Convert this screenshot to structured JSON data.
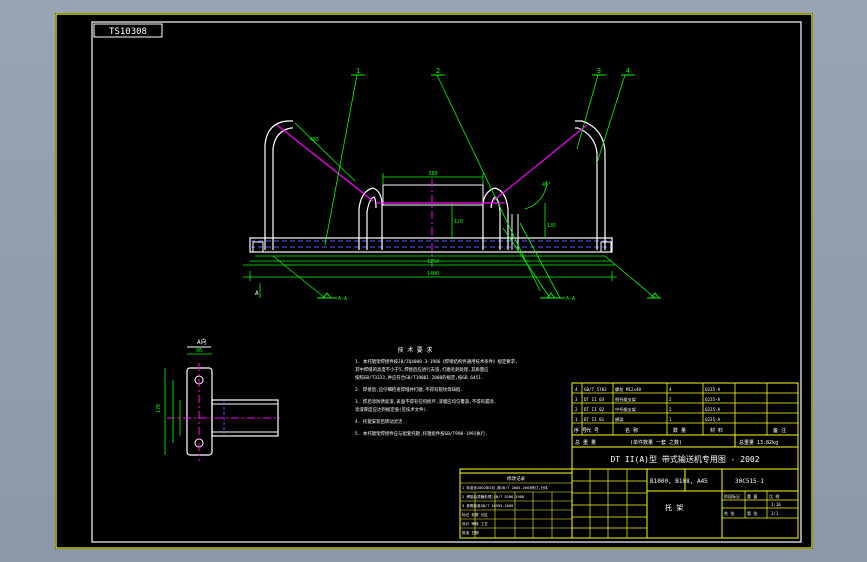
{
  "drawing": {
    "code_box": "TS10308",
    "part_labels": [
      "1",
      "2",
      "3",
      "4"
    ],
    "view_label": "A向",
    "section_label": "A",
    "weld_symbols": [
      "A-A",
      "A-A"
    ],
    "dims": {
      "center_len": "380",
      "center_h": "120",
      "side_len": "465",
      "angle": "45°",
      "total_w": "1250",
      "base_len": "1400",
      "side_h": "135",
      "plate_h": "170",
      "plate_w": "90"
    },
    "notes_title": "技 术 要 求",
    "notes": [
      "1. 本托辊架焊接件按JB/ZQ4000.3-1986《焊接结构件通用技术条件》规定要求,",
      "   其中焊缝的高度不小于5,焊接后应进行去渣,打磨毛刺处理,其质量应",
      "   按照GB/T3323,并应符合GB/T19001-2000的规定,按GB 6451.",
      "2. 焊接后,应仔细检查焊缝并打磨,不得有裂纹等缺陷.",
      "3. 焊后涂防锈底漆,表面不得有任何损坏,漆膜应均匀覆盖,不得有漏涂.",
      "   涂漆厚度应达到规定值(见技术文件).",
      "4. 托辊安装后转动灵活.",
      "5. 本托辊架焊接件应与配套托辊,托辊组件按GB/T990-1991执行."
    ],
    "mini_table_title": "修改记录",
    "mini_table_rows": [
      "1 标准化2002年5月,按JB/T 2003-2003修订,分体",
      "2 焊接后漆膜处理,GB/T 9286-1988",
      "3 参照标准GB/T 10595-2009",
      "标记  处数  分区",
      "设计  审核  工艺",
      "批准  日期"
    ]
  },
  "parts_list": {
    "rows": [
      {
        "no": "1",
        "code": "DT II 01",
        "name": "横梁",
        "qty": "1",
        "material": "Q235-A",
        "remark": ""
      },
      {
        "no": "2",
        "code": "DT II 02",
        "name": "中托辊支架",
        "qty": "2",
        "material": "Q235-A",
        "remark": ""
      },
      {
        "no": "3",
        "code": "DT II 03",
        "name": "侧托辊支架",
        "qty": "2",
        "material": "Q235-A",
        "remark": ""
      },
      {
        "no": "4",
        "code": "GB/T 5783",
        "name": "螺栓 M12×40",
        "qty": "4",
        "material": "Q235-A",
        "remark": ""
      }
    ],
    "header": [
      "序 号",
      "代 号",
      "名 称",
      "数 量",
      "材 料",
      "备 注"
    ]
  },
  "title_block": {
    "weight_label": "总 重 量",
    "standard_note": "(单件数量 一套 之数)",
    "total_weight": "总重量 13.82kg",
    "series_title": "DT II(A)型 带式输送机专用图 - 2002",
    "model": "B1000, B108, A45",
    "drawing_no": "30C515-1",
    "part_name": "托 架",
    "scale": "1:10",
    "sheet": "1/1",
    "labels": [
      "阶段标记",
      "重 量",
      "比 例",
      "共 张",
      "第 张"
    ]
  }
}
